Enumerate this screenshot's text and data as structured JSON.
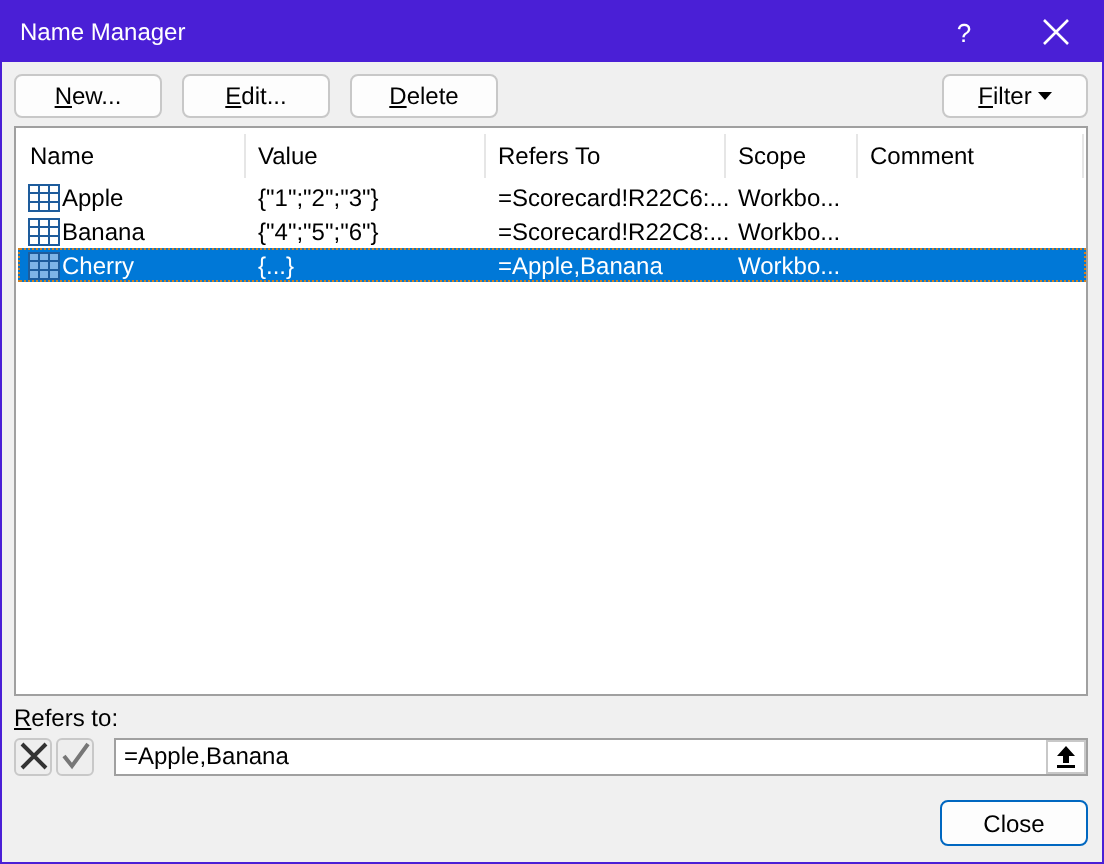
{
  "window": {
    "title": "Name Manager",
    "help": "?"
  },
  "buttons": [
    {
      "label": "New..."
    },
    {
      "label": "Edit..."
    },
    {
      "label": "Delete"
    }
  ],
  "filter_button": {
    "label": "Filter"
  },
  "table": {
    "columns": [
      "Name",
      "Value",
      "Refers To",
      "Scope",
      "Comment"
    ],
    "rows": [
      {
        "name": "Apple",
        "value": "{\"1\";\"2\";\"3\"}",
        "refers_to": "=Scorecard!R22C6:...",
        "scope": "Workbo...",
        "selected": false
      },
      {
        "name": "Banana",
        "value": "{\"4\";\"5\";\"6\"}",
        "refers_to": "=Scorecard!R22C8:...",
        "scope": "Workbo...",
        "selected": false
      },
      {
        "name": "Cherry",
        "value": "{...}",
        "refers_to": "=Apple,Banana",
        "scope": "Workbo...",
        "selected": true
      }
    ]
  },
  "refers_to": {
    "label": "Refers to:",
    "value": "=Apple,Banana"
  },
  "close_button": {
    "label": "Close"
  }
}
